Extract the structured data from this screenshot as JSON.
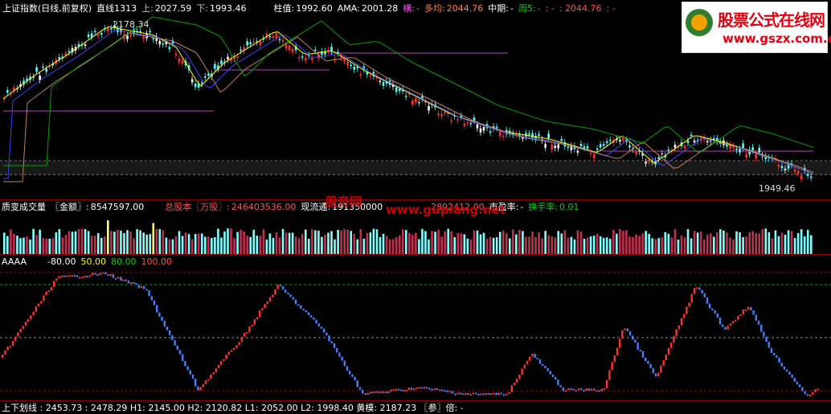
{
  "top": {
    "title": "上证指数(日线,前复权)",
    "trend_label": "直线1313",
    "upper_label": "上:",
    "upper_value": "2027.59",
    "lower_label": "下:",
    "lower_value": "1993.46",
    "col_label": "柱值:",
    "col_value": "1992.60",
    "ama_label": "AMA:",
    "ama_value": "2001.28",
    "horiz_label": "横:",
    "horiz_value": "-",
    "multi_label": "多均:",
    "multi_value": "2044.76",
    "mid_label": "中期:",
    "mid_value": "-",
    "week_label": "周5:",
    "week_value": "-",
    "extra1": ": -",
    "extra2": ": 2044.76",
    "extra3": ": -"
  },
  "main_chart": {
    "high_marker": "2178.34",
    "low_marker": "1949.46"
  },
  "volume": {
    "title": "质变成交量",
    "amount_label": "〖金额〗:",
    "amount_value": "8547597.00",
    "shares_label": "总股本〖万股〗:",
    "shares_value": "246403536.00",
    "float_label": "现流通:",
    "float_value": "191350000",
    "float2_value": "2892412.00",
    "pe_label": "市盈率:",
    "pe_value": "-",
    "turnover_label": "换手率:",
    "turnover_value": "0.01"
  },
  "indicator": {
    "name": "AAAA",
    "levels": [
      "-80.00",
      "50.00",
      "80.00",
      "100.00"
    ]
  },
  "bottom": {
    "text": "上下划线 : 2453.73 : 2478.29  H1: 2145.00  H2: 2120.82  L1: 2052.00  L2: 1998.40  黄模: 2187.23  〖参〗倍: -"
  },
  "watermark": {
    "title": "股票公式在线网",
    "url": "www.gszx.com.cn",
    "overlay1": "股帝网",
    "overlay2": "www.gupiang.net"
  },
  "colors": {
    "up": "#ff3030",
    "down": "#54fcfc",
    "ma_yellow": "#ffff00",
    "ma_blue": "#4040ff",
    "ma_green": "#00a000",
    "hline": "#c040c0",
    "dash_green": "#00a000",
    "dash_red": "#a00000"
  }
}
